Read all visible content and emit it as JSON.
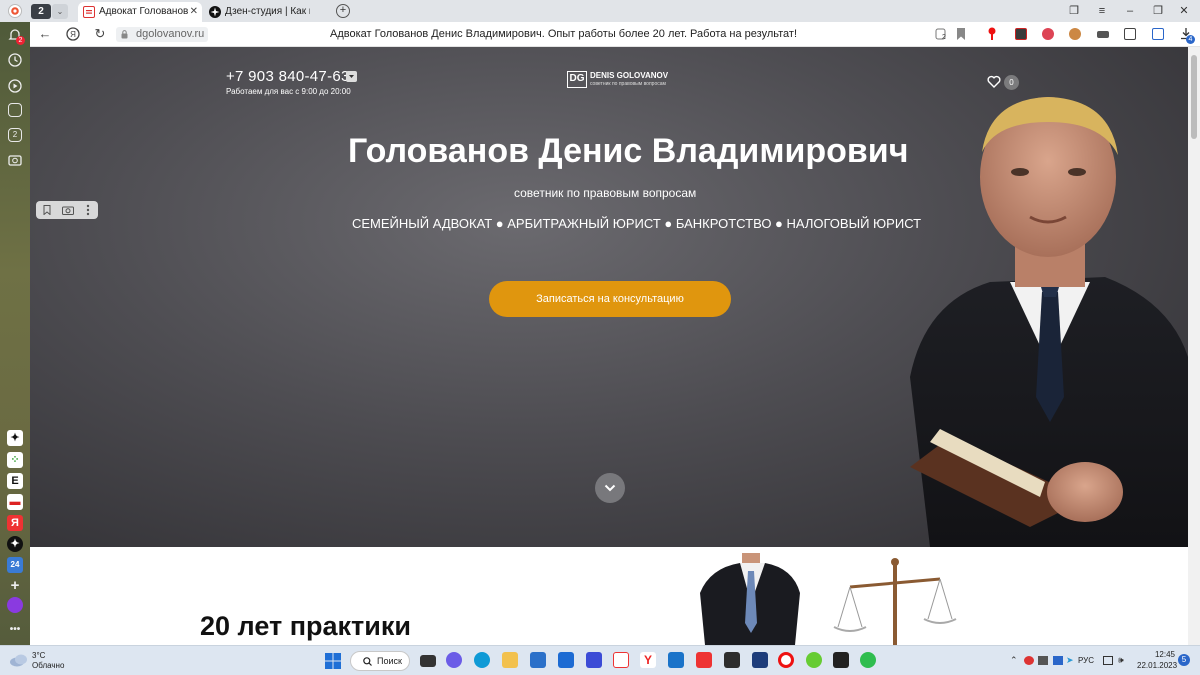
{
  "browser": {
    "tab_count": "2",
    "tabs": [
      {
        "title": "Адвокат Голованов Денис Владимирович",
        "active": true
      },
      {
        "title": "Дзен-студия | Как не нарушить",
        "active": false
      }
    ],
    "address": {
      "url": "dgolovanov.ru",
      "page_title": "Адвокат Голованов Денис Владимирович. Опыт работы более 20 лет. Работа на результат!"
    },
    "protect_badge": "2",
    "downloads_badge": "4",
    "sidebar_badges": {
      "notifications": "2",
      "collections": "2"
    }
  },
  "site": {
    "phone": "+7 903 840-47-63",
    "hours": "Работаем для вас с 9:00 до 20:00",
    "logo": {
      "mark": "DG",
      "name": "DENIS GOLOVANOV",
      "tagline": "советник по правовым вопросам"
    },
    "favorites_count": "0",
    "hero": {
      "title": "Голованов Денис Владимирович",
      "subtitle": "советник по правовым вопросам",
      "services": "СЕМЕЙНЫЙ АДВОКАТ ● АРБИТРАЖНЫЙ ЮРИСТ ● БАНКРОТСТВО ● НАЛОГОВЫЙ ЮРИСТ",
      "cta": "Записаться на консультацию"
    },
    "section2_title": "20 лет практики"
  },
  "taskbar": {
    "weather_temp": "3°C",
    "weather_desc": "Облачно",
    "search_label": "Поиск",
    "lang": "РУС",
    "time": "12:45",
    "date": "22.01.2023",
    "notif_badge": "5"
  },
  "colors": {
    "accent": "#e0960e",
    "hero_bg": "#4e4d52"
  }
}
